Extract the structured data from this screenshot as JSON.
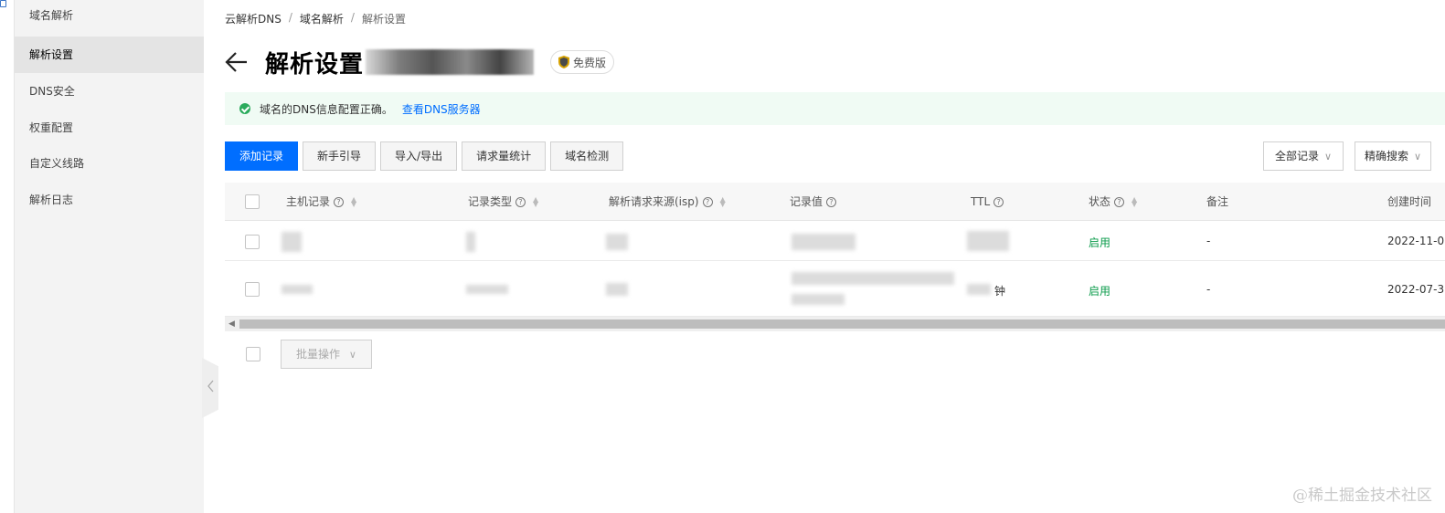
{
  "sidebar": {
    "items": [
      {
        "label": "域名解析"
      },
      {
        "label": "解析设置"
      },
      {
        "label": "DNS安全"
      },
      {
        "label": "权重配置"
      },
      {
        "label": "自定义线路"
      },
      {
        "label": "解析日志"
      }
    ]
  },
  "breadcrumb": [
    "云解析DNS",
    "域名解析",
    "解析设置"
  ],
  "header": {
    "title": "解析设置",
    "badge": "免费版"
  },
  "notice": {
    "text": "域名的DNS信息配置正确。",
    "link": "查看DNS服务器",
    "color": "#2bab5c"
  },
  "toolbar": {
    "buttons": [
      "添加记录",
      "新手引导",
      "导入/导出",
      "请求量统计",
      "域名检测"
    ],
    "filter_select": "全部记录",
    "search_mode": "精确搜索",
    "primary_color": "#006eff"
  },
  "table": {
    "columns": [
      "主机记录",
      "记录类型",
      "解析请求来源(isp)",
      "记录值",
      "TTL",
      "状态",
      "备注",
      "创建时间"
    ],
    "rows": [
      {
        "ttl": "",
        "status": "启用",
        "note": "-",
        "created": "2022-11-0"
      },
      {
        "ttl": "钟",
        "status": "启用",
        "note": "-",
        "created": "2022-07-3"
      }
    ]
  },
  "footer": {
    "batch_label": "批量操作"
  },
  "watermark": "@稀土掘金技术社区"
}
